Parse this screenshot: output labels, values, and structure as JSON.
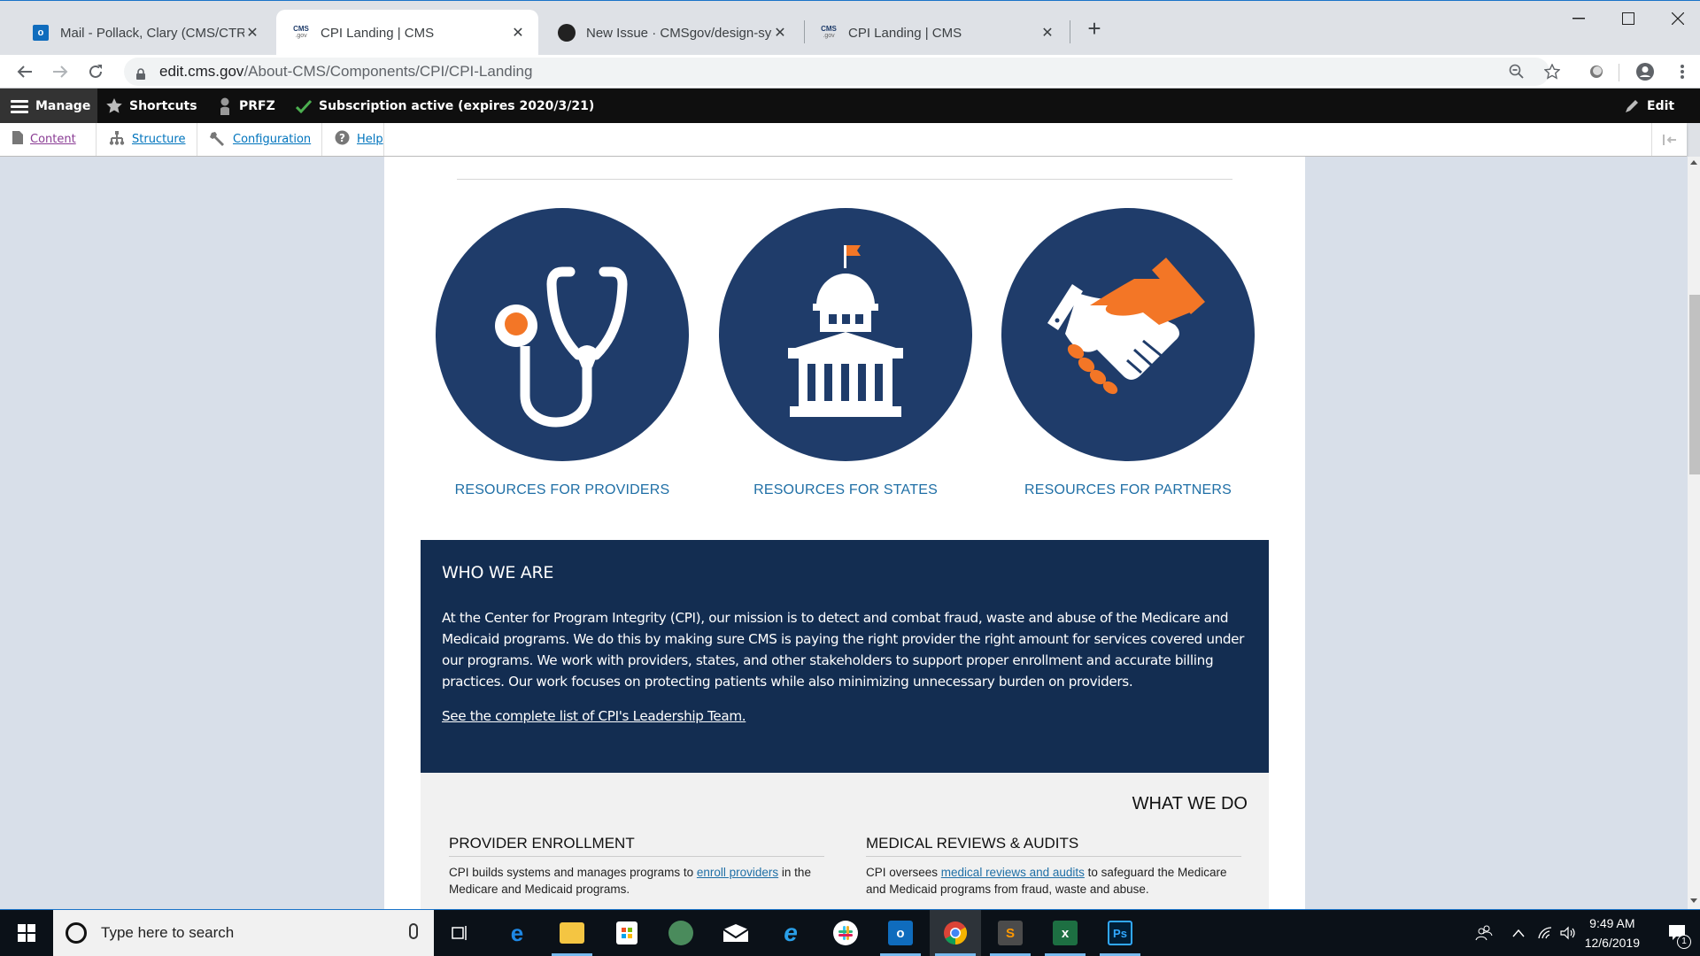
{
  "browser": {
    "tabs": [
      {
        "title": "Mail - Pollack, Clary (CMS/CTR) -",
        "favicon": "outlook-icon",
        "active": false
      },
      {
        "title": "CPI Landing | CMS",
        "favicon": "cms-gov-icon",
        "active": true
      },
      {
        "title": "New Issue · CMSgov/design-syst",
        "favicon": "github-icon",
        "active": false
      },
      {
        "title": "CPI Landing | CMS",
        "favicon": "cms-gov-icon",
        "active": false
      }
    ],
    "favicon_text": {
      "cms": "CMS",
      "gov": ".gov",
      "outlook": "o"
    },
    "new_tab_label": "+",
    "close_glyph": "✕",
    "url_host": "edit.cms.gov",
    "url_path": "/About-CMS/Components/CPI/CPI-Landing"
  },
  "admin_toolbar": {
    "manage": "Manage",
    "shortcuts": "Shortcuts",
    "user": "PRFZ",
    "subscription": "Subscription active (expires 2020/3/21)",
    "edit": "Edit",
    "tray": [
      {
        "label": "Content",
        "icon": "document-icon",
        "visited": true
      },
      {
        "label": "Structure",
        "icon": "sitemap-icon",
        "visited": false
      },
      {
        "label": "Configuration",
        "icon": "wrench-icon",
        "visited": false
      },
      {
        "label": "Help",
        "icon": "help-icon",
        "visited": false
      }
    ]
  },
  "page": {
    "resources": [
      {
        "label": "RESOURCES FOR PROVIDERS",
        "icon": "stethoscope-icon"
      },
      {
        "label": "RESOURCES FOR STATES",
        "icon": "capitol-building-icon"
      },
      {
        "label": "RESOURCES FOR PARTNERS",
        "icon": "handshake-icon"
      }
    ],
    "who_we_are": {
      "heading": "WHO WE ARE",
      "body": "At the Center for Program Integrity (CPI), our mission is to detect and combat fraud, waste and abuse of the Medicare and Medicaid programs. We do this by making sure CMS is paying the right provider the right amount for services covered under our programs. We work with providers, states, and other stakeholders to support proper enrollment and accurate billing practices. Our work focuses on protecting patients while also minimizing unnecessary burden on providers.",
      "link": "See the complete list of CPI's Leadership Team."
    },
    "what_we_do": {
      "heading": "WHAT WE DO",
      "items": [
        {
          "title": "PROVIDER ENROLLMENT",
          "before": "CPI builds systems and manages programs to ",
          "link": "enroll providers",
          "after": " in the Medicare and Medicaid programs."
        },
        {
          "title": "MEDICAL REVIEWS & AUDITS",
          "before": "CPI oversees ",
          "link": "medical reviews and audits",
          "after": " to safeguard the Medicare and Medicaid programs from fraud, waste and abuse."
        }
      ]
    },
    "colors": {
      "navy": "#1f3c6a",
      "dark_navy": "#132d51",
      "orange": "#f37626",
      "link": "#1f6fa6",
      "page_bg": "#d8dfe9"
    }
  },
  "taskbar": {
    "search_placeholder": "Type here to search",
    "apps": [
      "task-view",
      "edge",
      "file-explorer",
      "store",
      "network-app",
      "mail",
      "internet-explorer",
      "slack",
      "outlook",
      "chrome",
      "sublime-text",
      "excel",
      "photoshop"
    ],
    "time": "9:49 AM",
    "date": "12/6/2019",
    "notification_count": "1",
    "app_labels": {
      "outlook": "o",
      "excel": "x",
      "photoshop": "Ps",
      "sublime": "S"
    }
  }
}
